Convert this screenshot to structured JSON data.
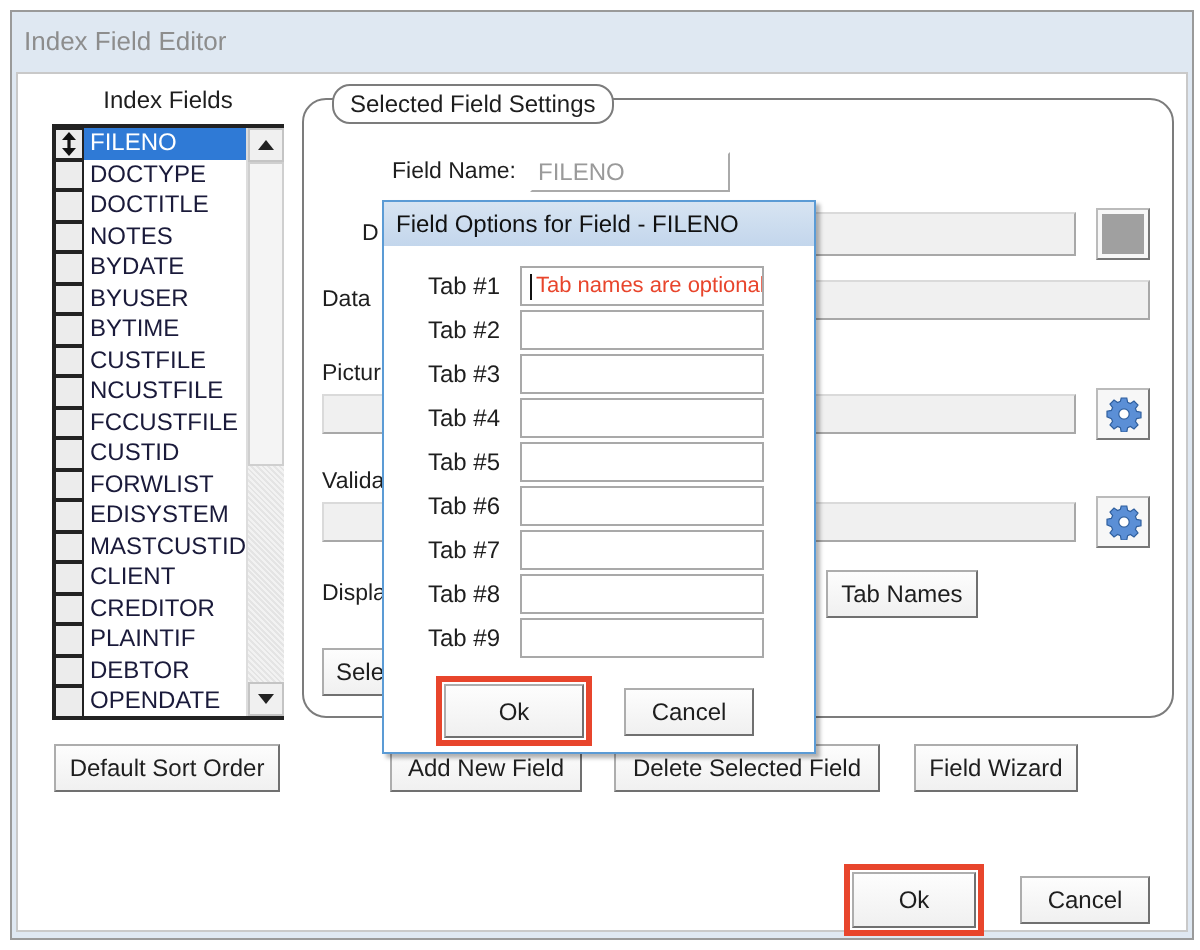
{
  "window": {
    "title": "Index Field Editor"
  },
  "index_fields": {
    "label": "Index Fields",
    "items": [
      {
        "name": "FILENO",
        "selected": true
      },
      {
        "name": "DOCTYPE",
        "selected": false
      },
      {
        "name": "DOCTITLE",
        "selected": false
      },
      {
        "name": "NOTES",
        "selected": false
      },
      {
        "name": "BYDATE",
        "selected": false
      },
      {
        "name": "BYUSER",
        "selected": false
      },
      {
        "name": "BYTIME",
        "selected": false
      },
      {
        "name": "CUSTFILE",
        "selected": false
      },
      {
        "name": "NCUSTFILE",
        "selected": false
      },
      {
        "name": "FCCUSTFILE",
        "selected": false
      },
      {
        "name": "CUSTID",
        "selected": false
      },
      {
        "name": "FORWLIST",
        "selected": false
      },
      {
        "name": "EDISYSTEM",
        "selected": false
      },
      {
        "name": "MASTCUSTID",
        "selected": false
      },
      {
        "name": "CLIENT",
        "selected": false
      },
      {
        "name": "CREDITOR",
        "selected": false
      },
      {
        "name": "PLAINTIF",
        "selected": false
      },
      {
        "name": "DEBTOR",
        "selected": false
      },
      {
        "name": "OPENDATE",
        "selected": false
      }
    ]
  },
  "settings": {
    "legend": "Selected Field Settings",
    "field_name": {
      "label": "Field Name:",
      "value": "FILENO"
    },
    "description_label": "D",
    "data_label": "Data",
    "picture_label": "Pictur",
    "validation_label": "Valida",
    "display_label": "Displa",
    "tab_names_button": "Tab Names",
    "select_button": "Sele"
  },
  "sort_button": "Default Sort Order",
  "field_buttons": [
    "Add New Field",
    "Delete Selected Field",
    "Field Wizard"
  ],
  "footer_buttons": [
    {
      "label": "Ok",
      "highlighted": true
    },
    {
      "label": "Cancel",
      "highlighted": false
    }
  ],
  "dialog": {
    "title": "Field Options for Field - FILENO",
    "tabs": [
      {
        "label": "Tab #1",
        "placeholder": "Tab names are optional",
        "focused": true
      },
      {
        "label": "Tab #2",
        "focused": false
      },
      {
        "label": "Tab #3",
        "focused": false
      },
      {
        "label": "Tab #4",
        "focused": false
      },
      {
        "label": "Tab #5",
        "focused": false
      },
      {
        "label": "Tab #6",
        "focused": false
      },
      {
        "label": "Tab #7",
        "focused": false
      },
      {
        "label": "Tab #8",
        "focused": false
      },
      {
        "label": "Tab #9",
        "focused": false
      }
    ],
    "buttons": [
      {
        "label": "Ok",
        "highlighted": true
      },
      {
        "label": "Cancel",
        "highlighted": false
      }
    ]
  }
}
